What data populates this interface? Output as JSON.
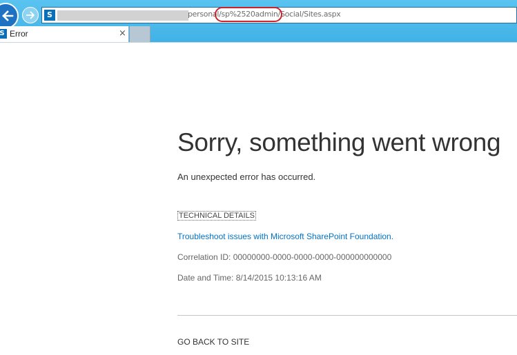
{
  "browser": {
    "address_bar": {
      "url_visible": "personal/sp%2520admin/Social/Sites.aspx",
      "site_icon": "sharepoint-s-icon",
      "highlight_color": "#d0202a"
    },
    "back_icon": "back-arrow-icon",
    "forward_icon": "forward-arrow-icon",
    "tab": {
      "icon": "sharepoint-s-icon",
      "title": "Error",
      "close_glyph": "×"
    },
    "colors": {
      "chrome": "#41b1e6",
      "back_button": "#1e72c1"
    }
  },
  "error_page": {
    "title": "Sorry, something went wrong",
    "message": "An unexpected error has occurred.",
    "technical_details_label": "TECHNICAL DETAILS",
    "troubleshoot_link": "Troubleshoot issues with Microsoft SharePoint Foundation.",
    "correlation": "Correlation ID: 00000000-0000-0000-0000-000000000000",
    "datetime": "Date and Time: 8/14/2015 10:13:16 AM",
    "go_back_label": "GO BACK TO SITE",
    "link_color": "#0072c6"
  }
}
